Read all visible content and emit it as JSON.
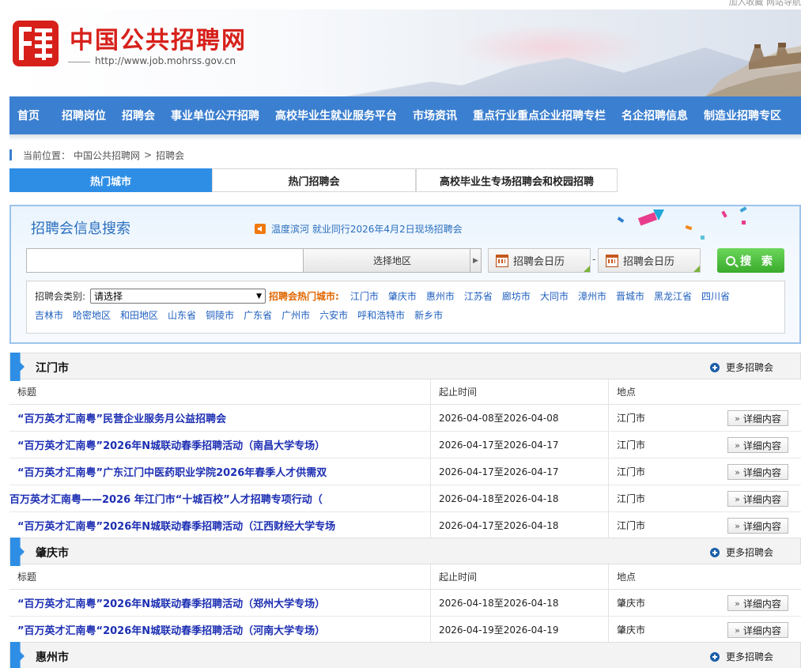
{
  "header": {
    "top_links": "加入收藏   网站导航",
    "site_title": "中国公共招聘网",
    "site_url": "http://www.job.mohrss.gov.cn"
  },
  "nav": {
    "items": [
      "首页",
      "招聘岗位",
      "招聘会",
      "事业单位公开招聘",
      "高校毕业生就业服务平台",
      "市场资讯",
      "重点行业重点企业招聘专栏",
      "名企招聘信息",
      "制造业招聘专区"
    ]
  },
  "breadcrumb": {
    "prefix": "当前位置：",
    "home": "中国公共招聘网",
    "sep": ">",
    "current": "招聘会"
  },
  "tabs": [
    {
      "label": "热门城市",
      "active": true
    },
    {
      "label": "热门招聘会",
      "active": false
    },
    {
      "label": "高校毕业生专场招聘会和校园招聘",
      "active": false
    }
  ],
  "search": {
    "title": "招聘会信息搜索",
    "notice": "温度滨河 就业同行2026年4月2日现场招聘会",
    "keyword_value": "",
    "region_button": "选择地区",
    "calendar_start": "招聘会日历",
    "calendar_end": "招聘会日历",
    "range_sep": "-",
    "search_button": "搜 索",
    "category_label": "招聘会类别:",
    "category_value": "请选择",
    "hot_cities_label": "招聘会热门城市:",
    "hot_cities_row1": [
      "江门市",
      "肇庆市",
      "惠州市",
      "江苏省",
      "廊坊市",
      "大同市",
      "漳州市",
      "晋城市",
      "黑龙江省",
      "四川省"
    ],
    "hot_cities_row2": [
      "吉林市",
      "哈密地区",
      "和田地区",
      "山东省",
      "铜陵市",
      "广东省",
      "广州市",
      "六安市",
      "呼和浩特市",
      "新乡市"
    ]
  },
  "table_headers": {
    "title": "标题",
    "time": "起止时间",
    "place": "地点"
  },
  "more_label": "更多招聘会",
  "detail_label": "详细内容",
  "sections": [
    {
      "city": "江门市",
      "rows": [
        {
          "title": "“百万英才汇南粤”民营企业服务月公益招聘会",
          "time": "2026-04-08至2026-04-08",
          "place": "江门市"
        },
        {
          "title": "“百万英才汇南粤”2026年N城联动春季招聘活动（南昌大学专场）",
          "time": "2026-04-17至2026-04-17",
          "place": "江门市"
        },
        {
          "title": "“百万英才汇南粤”广东江门中医药职业学院2026年春季人才供需双",
          "time": "2026-04-17至2026-04-17",
          "place": "江门市"
        },
        {
          "title": "百万英才汇南粤——2026 年江门市“十城百校”人才招聘专项行动（",
          "time": "2026-04-18至2026-04-18",
          "place": "江门市"
        },
        {
          "title": "“百万英才汇南粤”2026年N城联动春季招聘活动（江西财经大学专场",
          "time": "2026-04-17至2026-04-18",
          "place": "江门市"
        }
      ]
    },
    {
      "city": "肇庆市",
      "rows": [
        {
          "title": "“百万英才汇南粤”2026年N城联动春季招聘活动（郑州大学专场）",
          "time": "2026-04-18至2026-04-18",
          "place": "肇庆市"
        },
        {
          "title": "”百万英才汇南粤“2026年N城联动春季招聘活动（河南大学专场）",
          "time": "2026-04-19至2026-04-19",
          "place": "肇庆市"
        }
      ]
    },
    {
      "city": "惠州市",
      "rows": []
    }
  ]
}
